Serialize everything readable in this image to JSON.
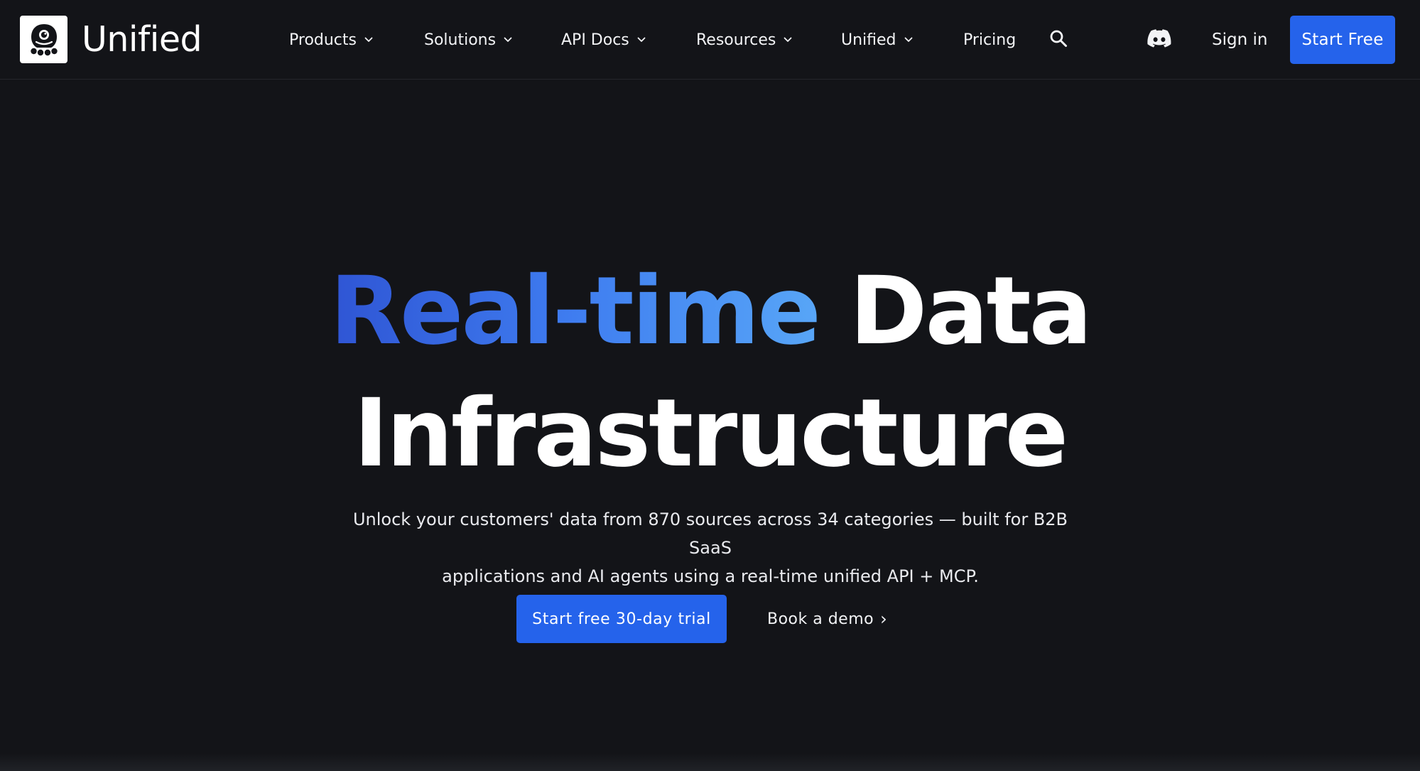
{
  "brand": {
    "name": "Unified",
    "accent": "#2563eb",
    "background": "#131418"
  },
  "nav": {
    "items": [
      {
        "label": "Products",
        "has_dropdown": true
      },
      {
        "label": "Solutions",
        "has_dropdown": true
      },
      {
        "label": "API Docs",
        "has_dropdown": true
      },
      {
        "label": "Resources",
        "has_dropdown": true
      },
      {
        "label": "Unified",
        "has_dropdown": true
      },
      {
        "label": "Pricing",
        "has_dropdown": false
      }
    ],
    "search_icon": "search-icon",
    "discord_icon": "discord-icon",
    "sign_in_label": "Sign in",
    "start_free_label": "Start Free"
  },
  "hero": {
    "title_highlight": "Real-time",
    "title_rest": "Data",
    "title_line2": "Infrastructure",
    "subtitle_line1": "Unlock your customers' data from 870 sources across 34 categories — built for B2B SaaS",
    "subtitle_line2": "applications and AI agents using a real-time unified API + MCP.",
    "primary_cta": "Start free 30-day trial",
    "secondary_cta": "Book a demo",
    "secondary_cta_arrow": "›"
  }
}
